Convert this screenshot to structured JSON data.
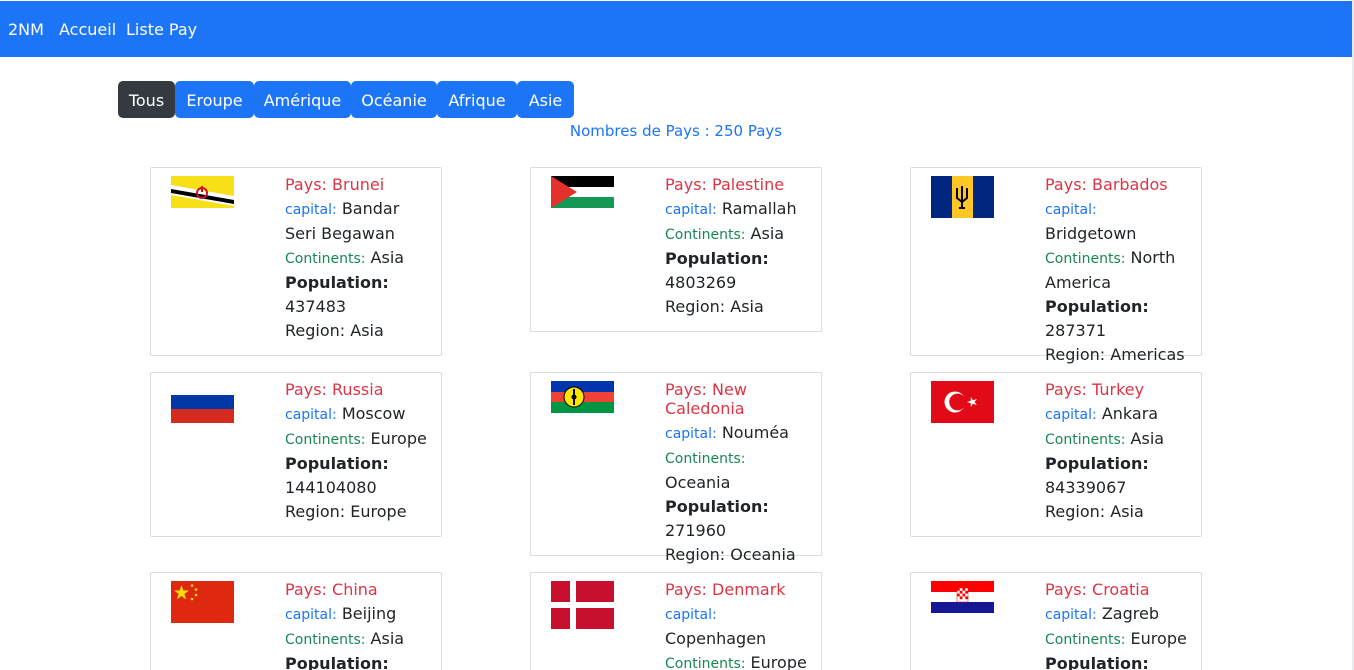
{
  "nav": {
    "brand": "2NM",
    "home": "Accueil",
    "list": "Liste Pay"
  },
  "filters": [
    "Tous",
    "Eroupe",
    "Amérique",
    "Océanie",
    "Afrique",
    "Asie"
  ],
  "active_filter": "Tous",
  "count_text": "Nombres de Pays : 250 Pays",
  "labels": {
    "country_prefix": "Pays:",
    "capital": "capital:",
    "continents": "Continents:",
    "population": "Population:",
    "region": "Region:"
  },
  "countries": [
    {
      "name": "Brunei",
      "capital": "Bandar Seri Begawan",
      "continent": "Asia",
      "population": "437483",
      "region": "Asia",
      "flag_icon": "brunei-flag-icon"
    },
    {
      "name": "Palestine",
      "capital": "Ramallah",
      "continent": "Asia",
      "population": "4803269",
      "region": "Asia",
      "flag_icon": "palestine-flag-icon"
    },
    {
      "name": "Barbados",
      "capital": "Bridgetown",
      "continent": "North America",
      "population": "287371",
      "region": "Americas",
      "flag_icon": "barbados-flag-icon"
    },
    {
      "name": "Russia",
      "capital": "Moscow",
      "continent": "Europe",
      "population": "144104080",
      "region": "Europe",
      "flag_icon": "russia-flag-icon"
    },
    {
      "name": "New Caledonia",
      "capital": "Nouméa",
      "continent": "Oceania",
      "population": "271960",
      "region": "Oceania",
      "flag_icon": "new-caledonia-flag-icon"
    },
    {
      "name": "Turkey",
      "capital": "Ankara",
      "continent": "Asia",
      "population": "84339067",
      "region": "Asia",
      "flag_icon": "turkey-flag-icon"
    },
    {
      "name": "China",
      "capital": "Beijing",
      "continent": "Asia",
      "population": "",
      "region": "",
      "flag_icon": "china-flag-icon"
    },
    {
      "name": "Denmark",
      "capital": "Copenhagen",
      "continent": "Europe",
      "population": "",
      "region": "",
      "flag_icon": "denmark-flag-icon"
    },
    {
      "name": "Croatia",
      "capital": "Zagreb",
      "continent": "Europe",
      "population": "",
      "region": "",
      "flag_icon": "croatia-flag-icon"
    }
  ],
  "colors": {
    "navbar": "#1c74f6",
    "active_filter": "#343a40",
    "country_name": "#dc3545",
    "capital_label": "#1c74f6",
    "continent_label": "#198754"
  }
}
